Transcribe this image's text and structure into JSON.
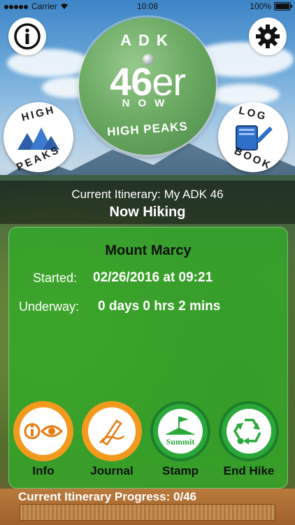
{
  "status_bar": {
    "carrier": "Carrier",
    "time": "10:08",
    "battery": "100%"
  },
  "logo": {
    "top": "ADK",
    "number": "46",
    "suffix": "er",
    "now": "NOW",
    "bottom": "HIGH PEAKS"
  },
  "badges": {
    "high_peaks": {
      "top": "HIGH",
      "bottom": "PEAKS"
    },
    "log_book": {
      "top": "LOG",
      "bottom": "BOOK"
    }
  },
  "banner": {
    "itinerary": "Current Itinerary: My ADK 46",
    "status": "Now Hiking"
  },
  "hike": {
    "peak": "Mount Marcy",
    "started_label": "Started:",
    "started_value": "02/26/2016 at 09:21",
    "underway_label": "Underway:",
    "underway_value": "0 days 0 hrs 2 mins"
  },
  "actions": {
    "info": "Info",
    "journal": "Journal",
    "stamp": "Stamp",
    "end": "End Hike",
    "summit_text": "Summit"
  },
  "progress": {
    "label": "Current Itinerary Progress: 0/46",
    "completed": 0,
    "total": 46
  },
  "colors": {
    "panel": "#32aa28",
    "orange": "#f39a1e",
    "green": "#2aa83a",
    "brown": "#a0602a"
  },
  "icons": [
    "info-icon",
    "gear-icon",
    "eye-icon",
    "pen-hand-icon",
    "summit-flag-icon",
    "recycle-icon",
    "book-pen-icon",
    "mountains-icon"
  ]
}
